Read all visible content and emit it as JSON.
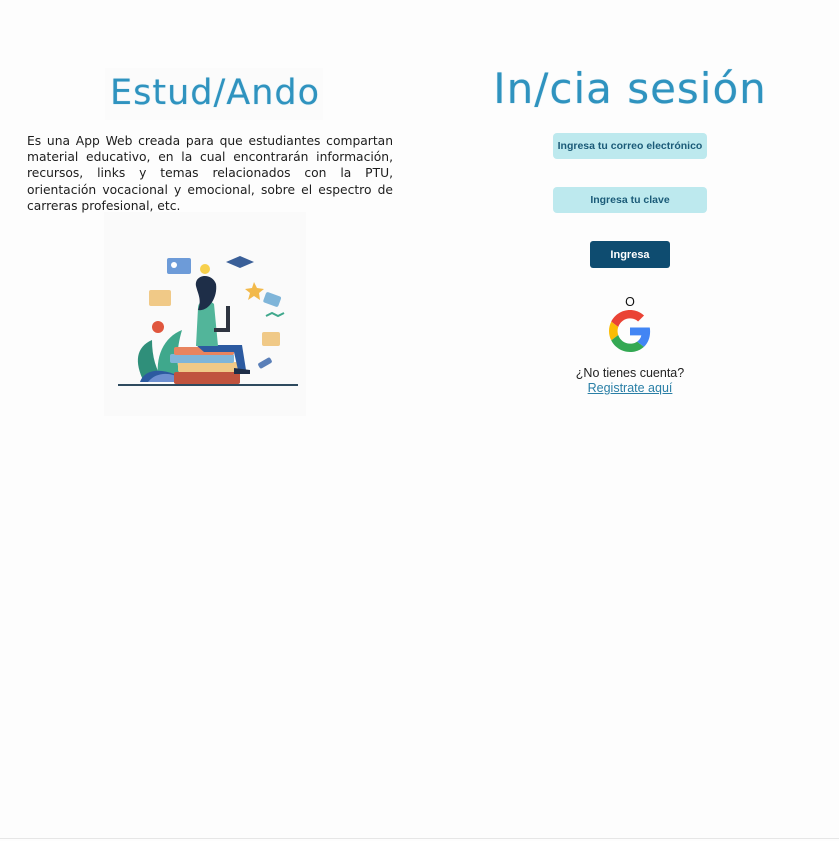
{
  "brand": {
    "logo_text": "Estud/Ando",
    "description": "Es una App Web creada para que estudiantes compartan material educativo, en la cual encontrarán información, recursos, links y temas relacionados con la PTU, orientación vocacional y emocional, sobre el espectro de carreras profesional, etc."
  },
  "login": {
    "title": "In/cia sesión",
    "email_placeholder": "Ingresa tu correo electrónico",
    "password_placeholder": "Ingresa tu clave",
    "submit_label": "Ingresa",
    "or_text": "O",
    "google_icon": "google-icon",
    "no_account_text": "¿No tienes cuenta?",
    "signup_link": "Registrate aquí"
  },
  "colors": {
    "accent": "#2f93bf",
    "field_bg": "#bde9ee",
    "button_bg": "#0e4c70"
  }
}
